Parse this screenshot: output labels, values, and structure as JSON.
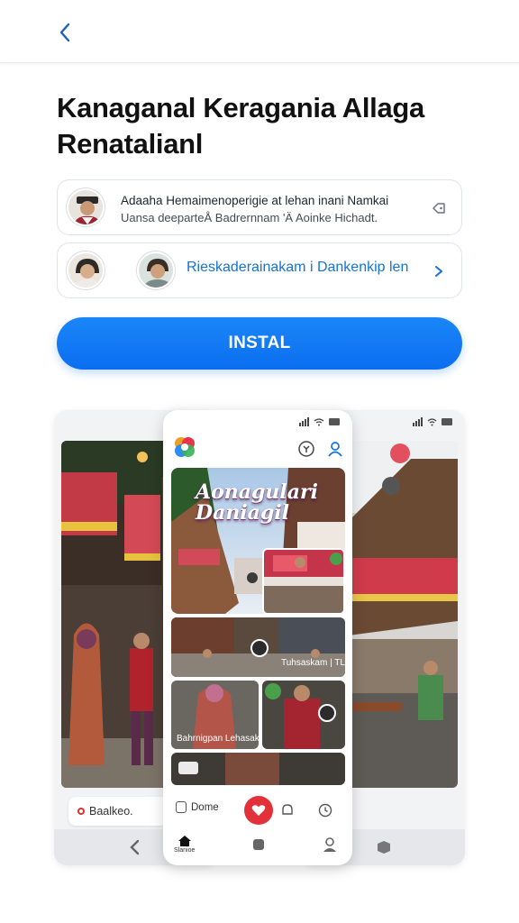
{
  "header": {
    "back_icon": "chevron-left-icon"
  },
  "title": "Kanaganal Keragania Allaga Renatalianl",
  "cards": [
    {
      "line1": "Adaaha Hemaimenoperigie at lehan inani Namkai",
      "line2": "Uansa deeparteÅ Badrernnam 'Ä Aoinke Hichadt.",
      "icon": "tag-icon"
    },
    {
      "link": "Rieskaderainakam i Dankenkip len",
      "icon": "chevron-right-icon"
    }
  ],
  "install_label": "INSTAL",
  "preview": {
    "hero_title": "Aonagulari Daniagil",
    "tile_caption_1": "Tuhsaskam | TLiÄh",
    "tile_caption_2": "Bahrnigpan Lehasaki.",
    "left_search": "Baalkeo.",
    "center_bottom_label": "Dome",
    "home_label": "Slanioe"
  },
  "colors": {
    "accent": "#0b6ef0",
    "link": "#1273d6",
    "fab": "#e3313c"
  }
}
